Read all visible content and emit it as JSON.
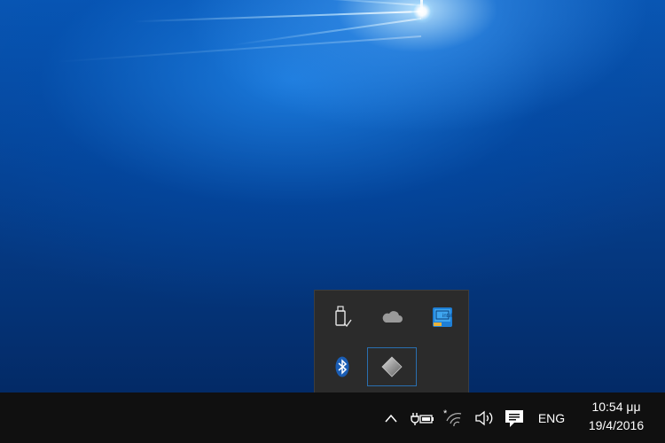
{
  "desktop": {
    "wallpaper": "windows-10-hero-blue",
    "colors": {
      "accent": "#0a57b3",
      "deep": "#032a66"
    }
  },
  "tray_flyout": {
    "icons": [
      {
        "name": "usb-safely-remove-icon"
      },
      {
        "name": "onedrive-cloud-icon"
      },
      {
        "name": "intel-graphics-icon"
      },
      {
        "name": "bluetooth-icon"
      },
      {
        "name": "diamond-app-icon",
        "selected": true
      }
    ],
    "colors": {
      "background": "#2b2b2b",
      "selection": "#2a6fb0"
    }
  },
  "taskbar": {
    "background": "#101010",
    "tray": {
      "show_hidden_icon": "chevron-up-icon",
      "power_icon": "power-battery-icon",
      "network_icon": "wifi-icon",
      "volume_icon": "speaker-icon",
      "notifications_icon": "action-center-icon",
      "language": "ENG"
    },
    "clock": {
      "time": "10:54 μμ",
      "date": "19/4/2016"
    }
  }
}
